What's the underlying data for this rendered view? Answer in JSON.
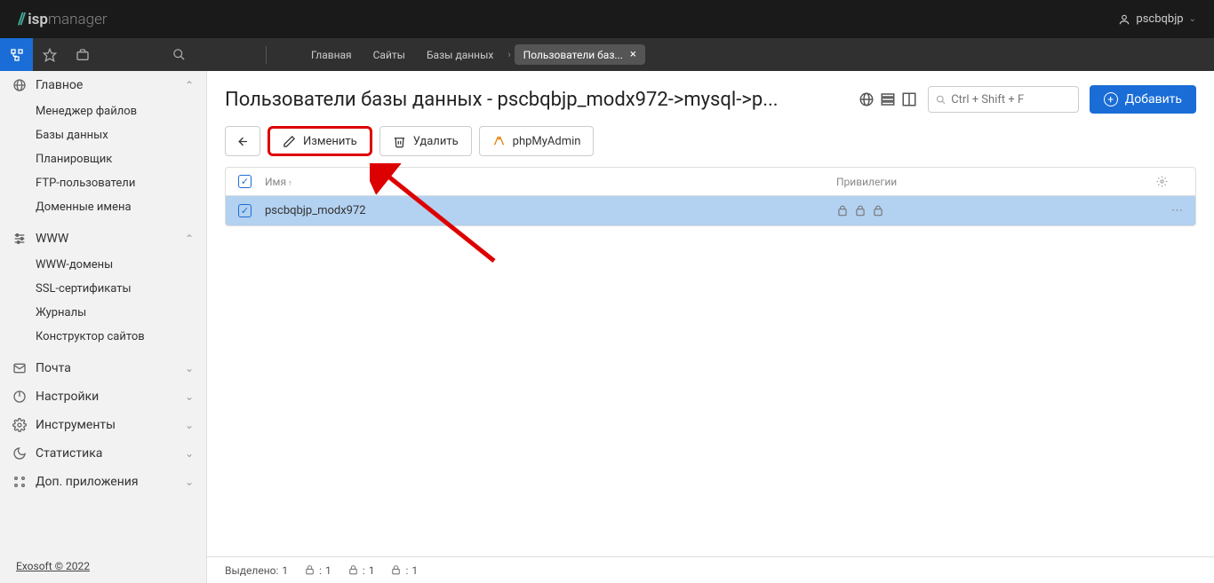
{
  "brand": {
    "name_light": "isp",
    "name_bold": "manager"
  },
  "user": {
    "name": "pscbqbjp"
  },
  "breadcrumbs": {
    "items": [
      "Главная",
      "Сайты",
      "Базы данных"
    ],
    "active_tab": "Пользователи баз..."
  },
  "sidebar": {
    "groups": [
      {
        "label": "Главное",
        "expanded": true,
        "items": [
          "Менеджер файлов",
          "Базы данных",
          "Планировщик",
          "FTP-пользователи",
          "Доменные имена"
        ]
      },
      {
        "label": "WWW",
        "expanded": true,
        "items": [
          "WWW-домены",
          "SSL-сертификаты",
          "Журналы",
          "Конструктор сайтов"
        ]
      },
      {
        "label": "Почта",
        "expanded": false,
        "items": []
      },
      {
        "label": "Настройки",
        "expanded": false,
        "items": []
      },
      {
        "label": "Инструменты",
        "expanded": false,
        "items": []
      },
      {
        "label": "Статистика",
        "expanded": false,
        "items": []
      },
      {
        "label": "Доп. приложения",
        "expanded": false,
        "items": []
      }
    ],
    "footer": "Exosoft © 2022"
  },
  "page": {
    "title": "Пользователи базы данных - pscbqbjp_modx972->mysql->p...",
    "search_placeholder": "Ctrl + Shift + F",
    "add_button": "Добавить"
  },
  "toolbar": {
    "edit": "Изменить",
    "delete": "Удалить",
    "phpmyadmin": "phpMyAdmin"
  },
  "table": {
    "headers": {
      "name": "Имя",
      "privileges": "Привилегии"
    },
    "rows": [
      {
        "name": "pscbqbjp_modx972",
        "checked": true
      }
    ]
  },
  "status": {
    "selected_label": "Выделено:",
    "selected_count": "1",
    "s1": "1",
    "s2": "1",
    "s3": "1"
  }
}
